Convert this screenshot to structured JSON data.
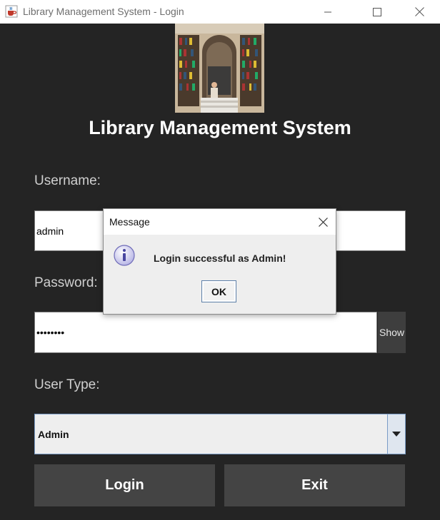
{
  "window": {
    "title": "Library Management System - Login",
    "app_icon": "java-cup-icon",
    "controls": [
      "minimize-icon",
      "maximize-icon",
      "close-icon"
    ]
  },
  "header": {
    "image": "library-photo",
    "title": "Library Management System"
  },
  "form": {
    "username_label": "Username:",
    "username_value": "admin",
    "password_label": "Password:",
    "password_value": "••••••••",
    "show_label": "Show",
    "usertype_label": "User Type:",
    "usertype_value": "Admin",
    "login_label": "Login",
    "exit_label": "Exit"
  },
  "dialog": {
    "title": "Message",
    "icon": "info-icon",
    "message": "Login successful as Admin!",
    "ok_label": "OK"
  },
  "colors": {
    "background": "#242424",
    "button": "#444444",
    "accent": "#7a9cc6"
  }
}
